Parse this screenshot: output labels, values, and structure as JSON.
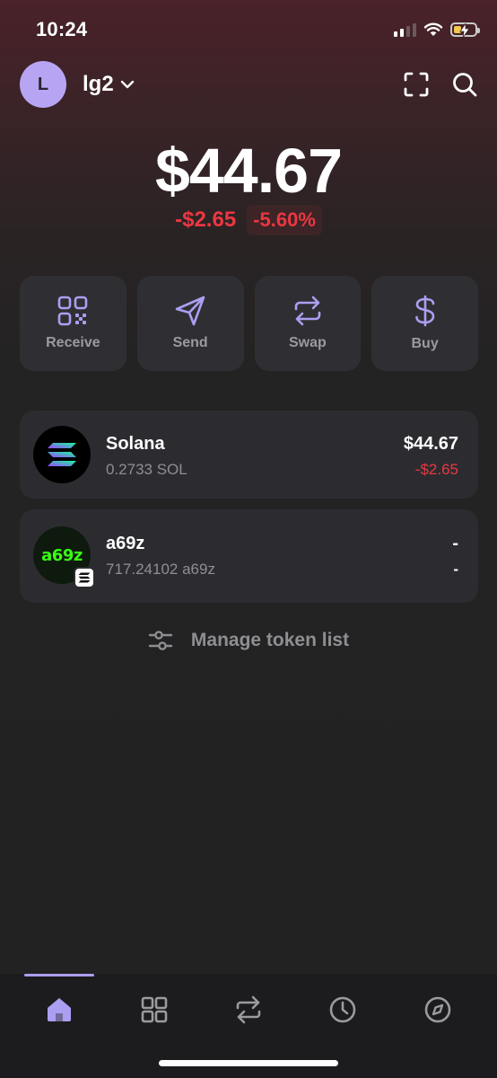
{
  "status_bar": {
    "time": "10:24"
  },
  "header": {
    "avatar_letter": "L",
    "account_name": "lg2"
  },
  "balance": {
    "total": "$44.67",
    "change_abs": "-$2.65",
    "change_pct": "-5.60%"
  },
  "actions": [
    {
      "label": "Receive",
      "icon": "qr-code-icon"
    },
    {
      "label": "Send",
      "icon": "paper-plane-icon"
    },
    {
      "label": "Swap",
      "icon": "swap-arrows-icon"
    },
    {
      "label": "Buy",
      "icon": "dollar-icon"
    }
  ],
  "tokens": [
    {
      "name": "Solana",
      "amount": "0.2733 SOL",
      "value": "$44.67",
      "change": "-$2.65"
    },
    {
      "name": "a69z",
      "amount": "717.24102 a69z",
      "value": "-",
      "change": "-",
      "logo_text": "a69z"
    }
  ],
  "manage": {
    "label": "Manage token list"
  },
  "tabs": [
    {
      "icon": "home-icon",
      "active": true
    },
    {
      "icon": "grid-icon"
    },
    {
      "icon": "swap-icon"
    },
    {
      "icon": "clock-icon"
    },
    {
      "icon": "compass-icon"
    }
  ],
  "colors": {
    "accent": "#ab9ff2",
    "negative": "#eb3742",
    "card": "#2f2f33",
    "background": "#222222"
  }
}
